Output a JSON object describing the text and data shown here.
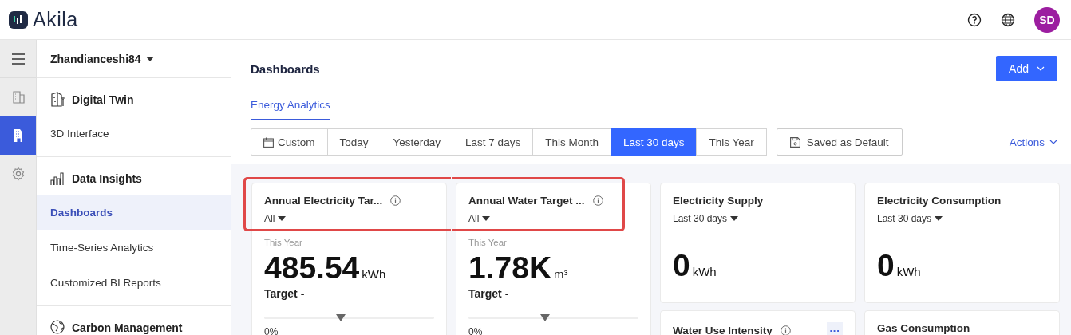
{
  "header": {
    "logo": "Akila",
    "avatar": "SD"
  },
  "rail": [
    {
      "kind": "menu",
      "selected": false
    },
    {
      "kind": "building",
      "selected": false
    },
    {
      "kind": "site",
      "selected": true
    },
    {
      "kind": "settings",
      "selected": false
    }
  ],
  "sidebar": {
    "site": "Zhandianceshi84",
    "sections": [
      {
        "kind": "twin",
        "title": "Digital Twin",
        "items": [
          {
            "label": "3D Interface",
            "selected": false
          }
        ]
      },
      {
        "kind": "insights",
        "title": "Data Insights",
        "items": [
          {
            "label": "Dashboards",
            "selected": true
          },
          {
            "label": "Time-Series Analytics",
            "selected": false
          },
          {
            "label": "Customized BI Reports",
            "selected": false
          }
        ]
      },
      {
        "kind": "carbon",
        "title": "Carbon Management"
      }
    ]
  },
  "page": {
    "title": "Dashboards",
    "add_button": "Add",
    "tabs": [
      {
        "label": "Energy Analytics",
        "selected": true
      }
    ],
    "ranges": [
      {
        "kind": "custom",
        "label": "Custom",
        "selected": false
      },
      {
        "kind": "plain",
        "label": "Today",
        "selected": false
      },
      {
        "kind": "plain",
        "label": "Yesterday",
        "selected": false
      },
      {
        "kind": "plain",
        "label": "Last 7 days",
        "selected": false
      },
      {
        "kind": "plain",
        "label": "This Month",
        "selected": false
      },
      {
        "kind": "plain",
        "label": "Last 30 days",
        "selected": true
      },
      {
        "kind": "plain",
        "label": "This Year",
        "selected": false
      }
    ],
    "save_default": "Saved as Default",
    "actions": "Actions"
  },
  "cards": [
    {
      "kind": "target",
      "title": "Annual Electricity Tar...",
      "info": true,
      "filter": "All",
      "period": "This Year",
      "value": "485.54",
      "unit": "kWh",
      "target": "Target -",
      "level": 0.45,
      "percent": "0%",
      "highlighted": true
    },
    {
      "kind": "target",
      "title": "Annual Water Target ...",
      "info": true,
      "filter": "All",
      "period": "This Year",
      "value": "1.78K",
      "unit": "m³",
      "target": "Target -",
      "level": 0.45,
      "percent": "0%",
      "highlighted": true
    },
    {
      "kind": "total",
      "title": "Electricity Supply",
      "info": false,
      "filter": "Last 30 days",
      "value": "0",
      "unit": "kWh",
      "highlighted": false
    },
    {
      "kind": "total",
      "title": "Electricity Consumption",
      "info": false,
      "filter": "Last 30 days",
      "value": "0",
      "unit": "kWh",
      "highlighted": false
    },
    {
      "kind": "intensity",
      "title": "Water Use Intensity",
      "info": true,
      "more": "···",
      "highlighted": false
    },
    {
      "kind": "plain",
      "title": "Gas Consumption",
      "info": false,
      "highlighted": false
    }
  ]
}
